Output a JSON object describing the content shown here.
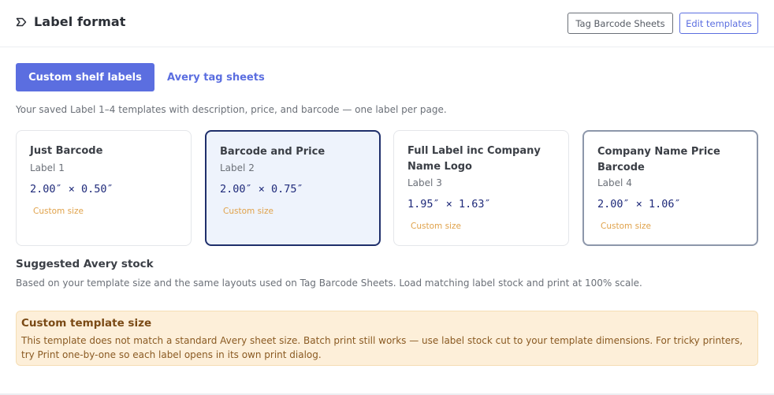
{
  "header": {
    "title": "Label format",
    "icon": "label-tag-icon",
    "buttons": {
      "tag_barcode_sheets": "Tag Barcode Sheets",
      "edit_templates": "Edit templates"
    }
  },
  "tabs": {
    "active": "Custom shelf labels",
    "inactive": "Avery tag sheets"
  },
  "description": "Your saved Label 1–4 templates with description, price, and barcode — one label per page.",
  "cards": [
    {
      "title": "Just Barcode",
      "label": "Label 1",
      "dims": "2.00″ × 0.50″",
      "size_note": "Custom size"
    },
    {
      "title": "Barcode and Price",
      "label": "Label 2",
      "dims": "2.00″ × 0.75″",
      "size_note": "Custom size"
    },
    {
      "title": "Full Label inc Company Name Logo",
      "label": "Label 3",
      "dims": "1.95″ × 1.63″",
      "size_note": "Custom size"
    },
    {
      "title": "Company Name Price Barcode",
      "label": "Label 4",
      "dims": "2.00″ × 1.06″",
      "size_note": "Custom size"
    }
  ],
  "selected_card": "Label 2",
  "suggested": {
    "heading": "Suggested Avery stock",
    "description": "Based on your template size and the same layouts used on Tag Barcode Sheets. Load matching label stock and print at 100% scale."
  },
  "alert": {
    "title": "Custom template size",
    "body": "This template does not match a standard Avery sheet size. Batch print still works — use label stock cut to your template dimensions. For tricky printers, try Print one-by-one so each label opens in its own print dialog."
  },
  "colors": {
    "accent": "#5b6ee0",
    "selected_border": "#1f2f6b",
    "selected_bg": "#eef3fc",
    "dims_text": "#1f2a7a",
    "custom_size_text": "#e0a24a",
    "alert_bg": "#fdefd9",
    "alert_title": "#7a4a15"
  }
}
